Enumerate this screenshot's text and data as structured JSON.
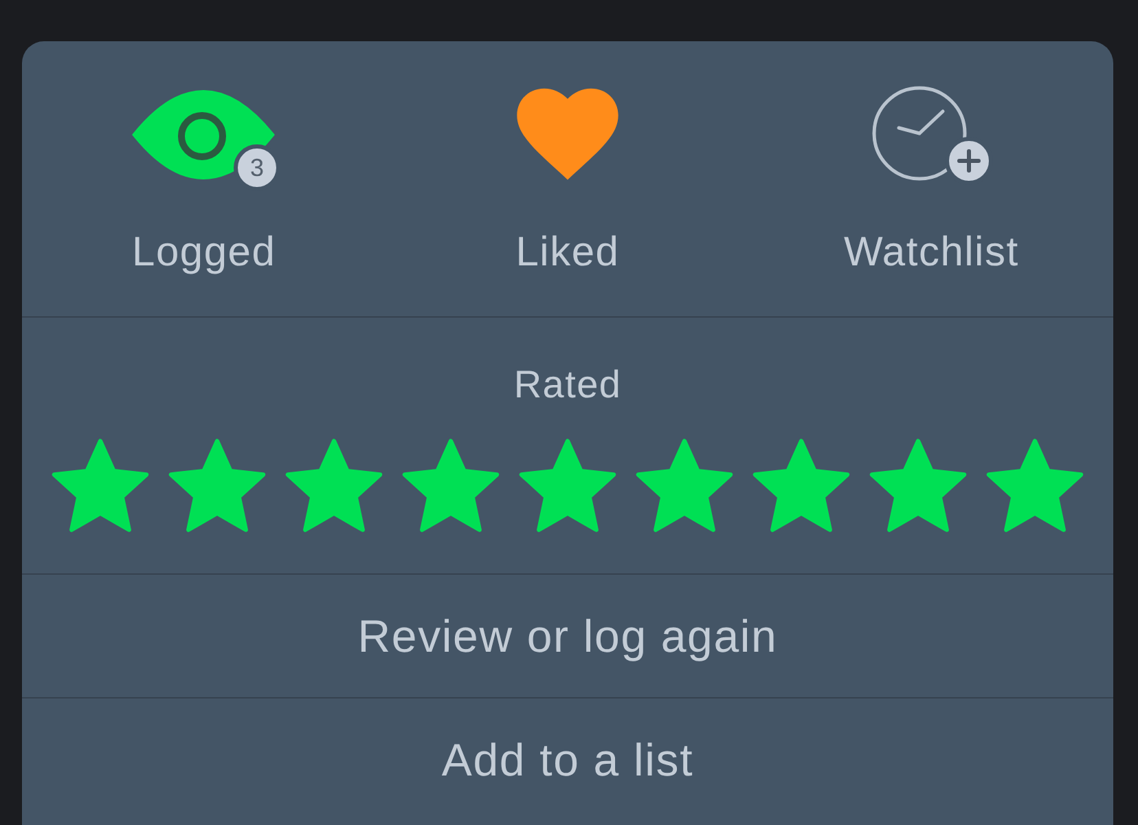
{
  "actions": [
    {
      "kind": "logged",
      "label": "Logged",
      "on": true,
      "count": "3"
    },
    {
      "kind": "liked",
      "label": "Liked",
      "on": true
    },
    {
      "kind": "watchlist",
      "label": "Watchlist",
      "on": false
    }
  ],
  "rating": {
    "label": "Rated",
    "stars": 9
  },
  "menu": [
    {
      "label": "Review or log again"
    },
    {
      "label": "Add to a list"
    }
  ]
}
